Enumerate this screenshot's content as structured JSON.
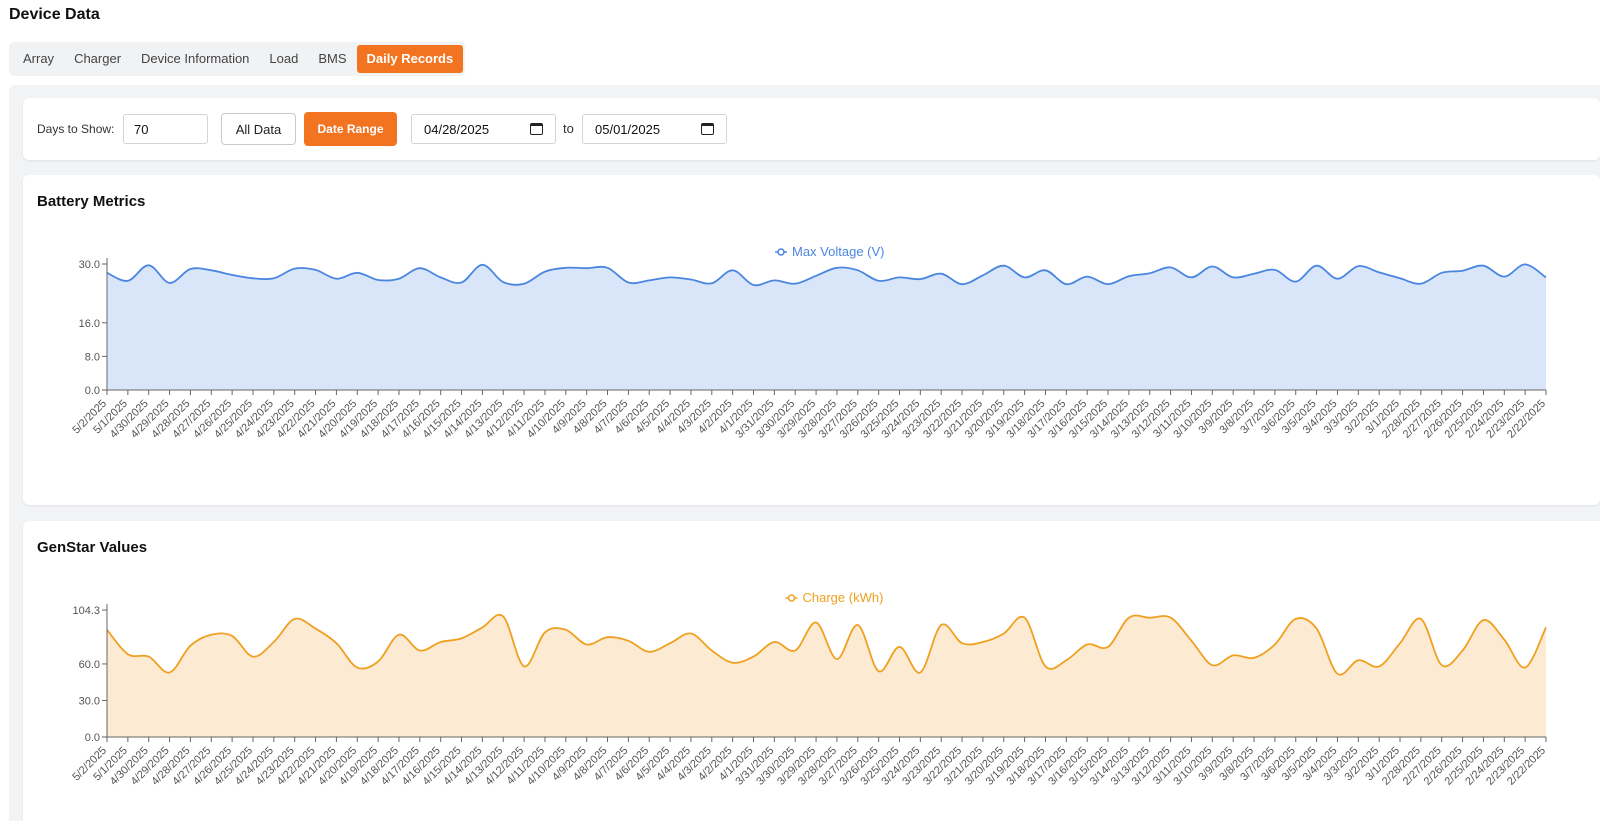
{
  "page": {
    "title": "Device Data"
  },
  "tabs": [
    {
      "label": "Array",
      "active": false
    },
    {
      "label": "Charger",
      "active": false
    },
    {
      "label": "Device Information",
      "active": false
    },
    {
      "label": "Load",
      "active": false
    },
    {
      "label": "BMS",
      "active": false
    },
    {
      "label": "Daily Records",
      "active": true
    }
  ],
  "filters": {
    "days_label": "Days to Show:",
    "days_value": "70",
    "all_data_label": "All Data",
    "date_range_label": "Date Range",
    "from_date": "04/28/2025",
    "to_label": "to",
    "to_date": "05/01/2025"
  },
  "colors": {
    "accent": "#f27421",
    "voltage_line": "#4a86e0",
    "voltage_fill": "#d9e6fa",
    "charge_line": "#f0a020",
    "charge_fill": "#fcebd2"
  },
  "chart_data": [
    {
      "type": "area",
      "card_title": "Battery Metrics",
      "title": "",
      "xlabel": "",
      "ylabel": "",
      "ylim": [
        0,
        30
      ],
      "yticks": [
        "0.0",
        "8.0",
        "16.0",
        "30.0"
      ],
      "legend_position": "top-center",
      "grid": false,
      "x": [
        "5/2/2025",
        "5/1/2025",
        "4/30/2025",
        "4/29/2025",
        "4/28/2025",
        "4/27/2025",
        "4/26/2025",
        "4/25/2025",
        "4/24/2025",
        "4/23/2025",
        "4/22/2025",
        "4/21/2025",
        "4/20/2025",
        "4/19/2025",
        "4/18/2025",
        "4/17/2025",
        "4/16/2025",
        "4/15/2025",
        "4/14/2025",
        "4/13/2025",
        "4/12/2025",
        "4/11/2025",
        "4/10/2025",
        "4/9/2025",
        "4/8/2025",
        "4/7/2025",
        "4/6/2025",
        "4/5/2025",
        "4/4/2025",
        "4/3/2025",
        "4/2/2025",
        "4/1/2025",
        "3/31/2025",
        "3/30/2025",
        "3/29/2025",
        "3/28/2025",
        "3/27/2025",
        "3/26/2025",
        "3/25/2025",
        "3/24/2025",
        "3/23/2025",
        "3/22/2025",
        "3/21/2025",
        "3/20/2025",
        "3/19/2025",
        "3/18/2025",
        "3/17/2025",
        "3/16/2025",
        "3/15/2025",
        "3/14/2025",
        "3/13/2025",
        "3/12/2025",
        "3/11/2025",
        "3/10/2025",
        "3/9/2025",
        "3/8/2025",
        "3/7/2025",
        "3/6/2025",
        "3/5/2025",
        "3/4/2025",
        "3/3/2025",
        "3/2/2025",
        "3/1/2025",
        "2/28/2025",
        "2/27/2025",
        "2/26/2025",
        "2/25/2025",
        "2/24/2025",
        "2/23/2025",
        "2/22/2025"
      ],
      "series": [
        {
          "name": "Max Voltage (V)",
          "values": [
            27.9,
            26.0,
            29.7,
            25.5,
            28.8,
            28.5,
            27.4,
            26.6,
            26.6,
            28.9,
            28.6,
            26.5,
            27.9,
            26.2,
            26.5,
            29.0,
            26.8,
            25.6,
            29.8,
            25.7,
            25.3,
            28.2,
            29.1,
            29.0,
            29.1,
            25.6,
            26.1,
            26.8,
            26.3,
            25.4,
            28.5,
            25.0,
            26.1,
            25.3,
            27.2,
            29.1,
            28.5,
            26.0,
            26.8,
            26.4,
            27.7,
            25.2,
            27.3,
            29.6,
            26.8,
            28.5,
            25.2,
            27.0,
            25.2,
            27.1,
            27.8,
            29.2,
            26.8,
            29.4,
            26.8,
            27.7,
            28.6,
            25.8,
            29.6,
            26.5,
            29.5,
            28.0,
            26.6,
            25.3,
            27.9,
            28.4,
            29.6,
            27.0,
            29.9,
            26.8
          ]
        }
      ]
    },
    {
      "type": "area",
      "card_title": "GenStar Values",
      "title": "",
      "xlabel": "",
      "ylabel": "",
      "ylim": [
        0,
        104.3
      ],
      "yticks": [
        "0.0",
        "30.0",
        "60.0",
        "104.3"
      ],
      "legend_position": "top-center",
      "grid": false,
      "x": [
        "5/2/2025",
        "5/1/2025",
        "4/30/2025",
        "4/29/2025",
        "4/28/2025",
        "4/27/2025",
        "4/26/2025",
        "4/25/2025",
        "4/24/2025",
        "4/23/2025",
        "4/22/2025",
        "4/21/2025",
        "4/20/2025",
        "4/19/2025",
        "4/18/2025",
        "4/17/2025",
        "4/16/2025",
        "4/15/2025",
        "4/14/2025",
        "4/13/2025",
        "4/12/2025",
        "4/11/2025",
        "4/10/2025",
        "4/9/2025",
        "4/8/2025",
        "4/7/2025",
        "4/6/2025",
        "4/5/2025",
        "4/4/2025",
        "4/3/2025",
        "4/2/2025",
        "4/1/2025",
        "3/31/2025",
        "3/30/2025",
        "3/29/2025",
        "3/28/2025",
        "3/27/2025",
        "3/26/2025",
        "3/25/2025",
        "3/24/2025",
        "3/23/2025",
        "3/22/2025",
        "3/21/2025",
        "3/20/2025",
        "3/19/2025",
        "3/18/2025",
        "3/17/2025",
        "3/16/2025",
        "3/15/2025",
        "3/14/2025",
        "3/13/2025",
        "3/12/2025",
        "3/11/2025",
        "3/10/2025",
        "3/9/2025",
        "3/8/2025",
        "3/7/2025",
        "3/6/2025",
        "3/5/2025",
        "3/4/2025",
        "3/3/2025",
        "3/2/2025",
        "3/1/2025",
        "2/28/2025",
        "2/27/2025",
        "2/26/2025",
        "2/25/2025",
        "2/24/2025",
        "2/23/2025",
        "2/22/2025"
      ],
      "series": [
        {
          "name": "Charge (kWh)",
          "values": [
            88,
            68,
            66,
            53,
            75,
            84,
            83,
            66,
            78,
            97,
            89,
            77,
            57,
            62,
            84,
            71,
            78,
            81,
            90,
            99,
            58,
            86,
            88,
            76,
            82,
            79,
            70,
            77,
            85,
            71,
            61,
            66,
            78,
            71,
            94,
            64,
            92,
            54,
            74,
            53,
            92,
            77,
            78,
            85,
            98,
            58,
            63,
            76,
            74,
            98,
            98,
            98,
            79,
            59,
            67,
            65,
            76,
            97,
            89,
            52,
            63,
            58,
            77,
            97,
            59,
            71,
            96,
            80,
            57,
            90
          ]
        }
      ]
    }
  ]
}
